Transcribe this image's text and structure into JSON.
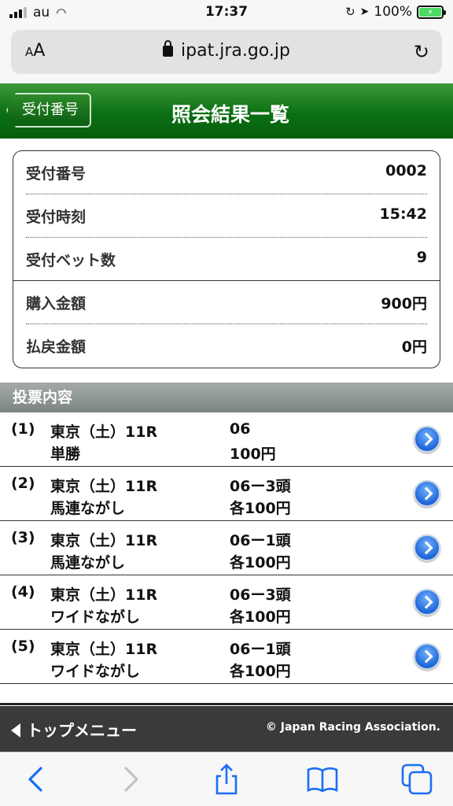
{
  "status_bar": {
    "carrier": "au",
    "time": "17:37",
    "battery": "100%"
  },
  "browser": {
    "aa_label": "AA",
    "domain": "ipat.jra.go.jp"
  },
  "header": {
    "back_label": "受付番号",
    "title": "照会結果一覧"
  },
  "summary": [
    {
      "label": "受付番号",
      "value": "0002"
    },
    {
      "label": "受付時刻",
      "value": "15:42"
    },
    {
      "label": "受付ベット数",
      "value": "9"
    },
    {
      "label": "購入金額",
      "value": "900円"
    },
    {
      "label": "払戻金額",
      "value": "0円"
    }
  ],
  "section_title": "投票内容",
  "bets": [
    {
      "num": "(1)",
      "race": "東京（土）11R",
      "type": "単勝",
      "selection": "06",
      "amount": "100円"
    },
    {
      "num": "(2)",
      "race": "東京（土）11R",
      "type": "馬連ながし",
      "selection": "06ー3頭",
      "amount": "各100円"
    },
    {
      "num": "(3)",
      "race": "東京（土）11R",
      "type": "馬連ながし",
      "selection": "06ー1頭",
      "amount": "各100円"
    },
    {
      "num": "(4)",
      "race": "東京（土）11R",
      "type": "ワイドながし",
      "selection": "06ー3頭",
      "amount": "各100円"
    },
    {
      "num": "(5)",
      "race": "東京（土）11R",
      "type": "ワイドながし",
      "selection": "06ー1頭",
      "amount": "各100円"
    }
  ],
  "footer": {
    "top_menu": "トップメニュー",
    "copyright": "© Japan Racing Association."
  },
  "colors": {
    "header_green": "#0b6f14",
    "link_blue": "#1a6ef5",
    "section_gray": "#7b847f"
  }
}
